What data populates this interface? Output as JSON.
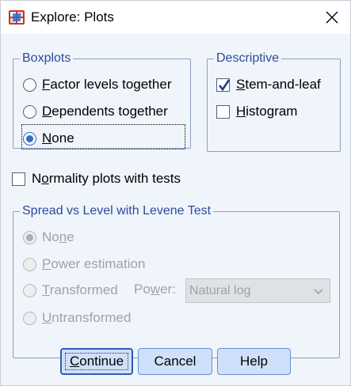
{
  "window": {
    "title": "Explore: Plots",
    "close_label": "×"
  },
  "boxplots": {
    "legend": "Boxplots",
    "options": [
      {
        "label_ul": "F",
        "label_rest": "actor levels together",
        "checked": false
      },
      {
        "label_ul": "D",
        "label_rest": "ependents together",
        "checked": false
      },
      {
        "label_ul": "N",
        "label_rest": "one",
        "checked": true
      }
    ]
  },
  "descriptive": {
    "legend": "Descriptive",
    "items": [
      {
        "label_ul": "S",
        "label_rest": "tem-and-leaf",
        "checked": true
      },
      {
        "label_ul": "H",
        "label_rest": "istogram",
        "checked": false
      }
    ]
  },
  "normality": {
    "label_pre": "N",
    "label_ul": "o",
    "label_rest": "rmality plots with tests",
    "checked": false
  },
  "spread": {
    "legend": "Spread vs Level with Levene Test",
    "options": [
      {
        "label_pre": "",
        "label_ul": "",
        "label_rest": "None",
        "ul_index": 2,
        "checked": true
      },
      {
        "label_pre": "",
        "label_ul": "P",
        "label_rest": "ower estimation",
        "checked": false
      },
      {
        "label_pre": "",
        "label_ul": "T",
        "label_rest": "ransformed",
        "checked": false
      },
      {
        "label_pre": "",
        "label_ul": "U",
        "label_rest": "ntransformed",
        "checked": false
      }
    ],
    "none_a": "No",
    "none_ul": "n",
    "none_b": "e",
    "power_a": "Po",
    "power_ul": "w",
    "power_b": "er:",
    "power_value": "Natural log"
  },
  "buttons": {
    "continue_ul": "C",
    "continue_rest": "ontinue",
    "cancel": "Cancel",
    "help": "Help"
  },
  "colors": {
    "accent": "#2f6fd0",
    "legend": "#2b4c9a",
    "button_bg": "#cfe0fb",
    "dialog_bg": "#f0f4fb"
  }
}
